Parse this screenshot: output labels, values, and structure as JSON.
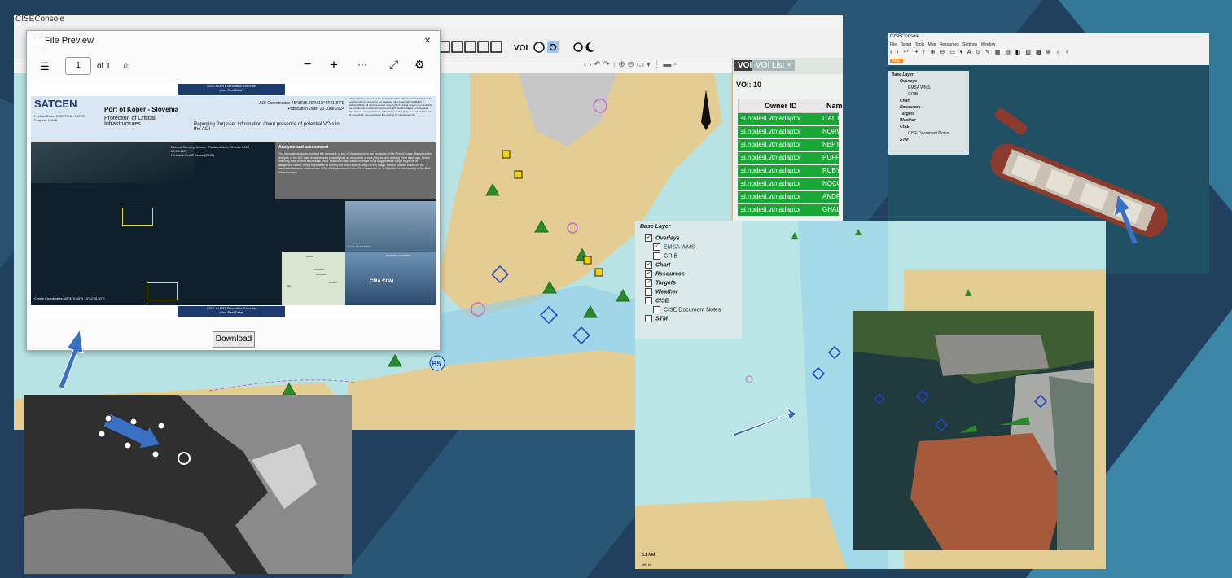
{
  "main_console": {
    "title": "CISEConsole",
    "toolbar_voi": "VOI",
    "tab_label": "VOI List",
    "voi_count": "VOI: 10",
    "table_headers": [
      "Owner ID",
      "Name"
    ],
    "rows": [
      {
        "owner": "si.nodesi.vtmadaptor",
        "name": "ITAL BO"
      },
      {
        "owner": "si.nodesi.vtmadaptor",
        "name": "NORW"
      },
      {
        "owner": "si.nodesi.vtmadaptor",
        "name": "NEPTU"
      },
      {
        "owner": "si.nodesi.vtmadaptor",
        "name": "PUFFIN"
      },
      {
        "owner": "si.nodesi.vtmadaptor",
        "name": "RUBY"
      },
      {
        "owner": "si.nodesi.vtmadaptor",
        "name": "NOCC"
      },
      {
        "owner": "si.nodesi.vtmadaptor",
        "name": "ANDRO"
      },
      {
        "owner": "si.nodesi.vtmadaptor",
        "name": "GHAL"
      }
    ],
    "map_label_b5": "B5"
  },
  "file_preview": {
    "title": "File Preview",
    "page_value": "1",
    "page_of": "of 1",
    "download_label": "Download",
    "doc": {
      "banner_top": "CISE-ALERT Simulation Exercise\n(Non-Real Data)",
      "logo": "SATCEN",
      "product_code": "Product Code: CISE TRIAL 000 001\nRequest: HMuD",
      "heading": "Port of Koper - Slovenia",
      "subheading": "Protection of Critical Infrastructures",
      "aoi": "AOI Coordinates: 45°33'35.20\"N 13°44'21.87\"E",
      "pub_date": "Publication Date: 20 June 2024",
      "purpose": "Reporting Purpose: Information about presence of potential VOIs in the AOI",
      "legal": "This product is covered by the Council Decision of 23 September 2024 on the security rules for protecting EU classified information (2013/488/EU) © SatCen (2024), all rights reserved. Copyright of original imagery remains with the provider. EU Institutions and bodies, EU Member States or designated third states and organisations, within the meaning of the Council Decision of 26 June 2024, may reproduce this product for official use only.",
      "source": "Remote Sensing Source: Pléiades-Neo, 19 June 2024\n09:55:11Z\nPléiades-Neo © Airbus (2024)",
      "analysis_title": "Analysis and assessment",
      "analysis_text": "The thorough analysis revealed the presence of two VOIs anchored in the proximity of the Port of Koper. Based on the analysis of the AIS data, those vessels possibly had an encounter at sea (ship-to-ship activity) three days ago, before reaching their current anchorage point. Historical data related to these VOIs suggest their cargo might be of dangerous nature, being impossible to specify the exact type of cargo at this stage. Please not that based on the described behavior of these two VOIs, their presence in the AOI is assessed as of high risk for the security of the Port infrastructures.",
      "centre": "Centre Coordinates: 45°34'0.00\"N 13°42'45.30\"E",
      "banner_bottom": "CISE-ALERT Simulation Exercise\n(Non-Real Data)",
      "ship_label": "IMO/MMSI 212349878",
      "source_small": "Source: MarineTraffic",
      "map_label_country": "Slovenia",
      "map_label_city": "Ljubljana",
      "map_label_croatia": "Croatia",
      "map_label_austria": "Austria",
      "map_label_italy": "Italy",
      "ship_brand": "CMA CGM"
    }
  },
  "mini_console": {
    "title": "CISEConsole",
    "menu": [
      "File",
      "Target",
      "Tools",
      "Map",
      "Resources",
      "Settings",
      "Window"
    ],
    "map_tab": "Map",
    "layers": [
      "Base Layer",
      "Overlays",
      "EMSA WMS",
      "GRIB",
      "Chart",
      "Resources",
      "Targets",
      "Weather",
      "CISE",
      "CISE Document Notes",
      "STM"
    ]
  },
  "right_map": {
    "layers": [
      {
        "label": "Base Layer",
        "checked": false
      },
      {
        "label": "Overlays",
        "checked": true
      },
      {
        "label": "EMSA WMS",
        "checked": true
      },
      {
        "label": "GRIB",
        "checked": false
      },
      {
        "label": "Chart",
        "checked": true
      },
      {
        "label": "Resources",
        "checked": true
      },
      {
        "label": "Targets",
        "checked": true
      },
      {
        "label": "Weather",
        "checked": false
      },
      {
        "label": "CISE",
        "checked": false
      },
      {
        "label": "CISE Document Notes",
        "checked": false
      },
      {
        "label": "STM",
        "checked": false
      }
    ],
    "scale_label": "0.1 NM",
    "scale_sub": "180 m"
  },
  "colors": {
    "background": "#1e3d5a",
    "sea": "#b9e5e6",
    "land": "#e3cd93",
    "voi_green": "#19a835",
    "arrow_blue": "#3a70c4"
  }
}
